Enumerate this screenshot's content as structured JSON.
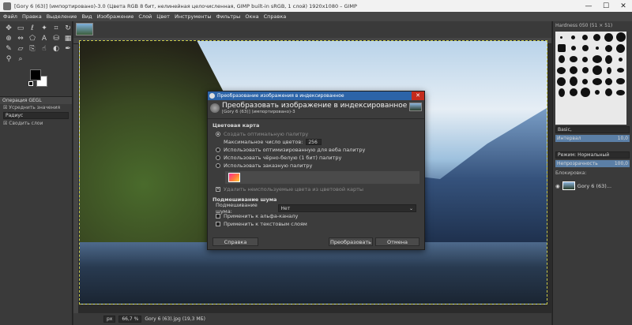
{
  "window": {
    "title": "[Gory 6 (63)] (импортировано)-3.0 (Цвета RGB 8 бит, нелинейная целочисленная, GIMP built-in sRGB, 1 слой) 1920x1080 – GIMP",
    "controls": [
      "—",
      "☐",
      "✕"
    ]
  },
  "menu": [
    "Файл",
    "Правка",
    "Выделение",
    "Вид",
    "Изображение",
    "Слой",
    "Цвет",
    "Инструменты",
    "Фильтры",
    "Окна",
    "Справка"
  ],
  "left_dock": {
    "tab_label": "Операция GEGL",
    "gegl_option": "Усреднить значения",
    "gegl_field": "Радиус",
    "gegl_merge": "Сводить слои"
  },
  "statusbar": {
    "unit": "px",
    "zoom": "66,7 %",
    "info": "Gory 6 (63).jpg (19,3 МБ)"
  },
  "right_dock": {
    "brush_name": "Hardness 050 (51 × 51)",
    "brush_tag": "Basic,",
    "spacing_label": "Интервал",
    "spacing_value": "10,0",
    "mode_label": "Режим: Нормальный",
    "opacity_label": "Непрозрачность",
    "opacity_value": "100,0",
    "lock_label": "Блокировка:",
    "layer_name": "Gory 6 (63)..."
  },
  "dialog": {
    "titlebar": "Преобразование изображения в индексированное",
    "heading": "Преобразовать изображение в индексированное",
    "subheading": "[Gory 6 (63)] (импортировано)-3",
    "section_colormap": "Цветовая карта",
    "opt_optimal": "Создать оптимальную палитру",
    "max_colors_label": "Максимальное число цветов:",
    "max_colors_value": "256",
    "opt_web": "Использовать оптимизированную для веба палитру",
    "opt_bw": "Использовать чёрно-белую (1 бит) палитру",
    "opt_custom": "Использовать заказную палитру",
    "remove_unused": "Удалить неиспользуемые цвета из цветовой карты",
    "section_dither": "Подмешивание шума",
    "dither_label": "Подмешивание шума:",
    "dither_value": "Нет",
    "dither_alpha": "Применить к альфа-каналу",
    "dither_text": "Применить к текстовым слоям",
    "btn_help": "Справка",
    "btn_convert": "Преобразовать",
    "btn_cancel": "Отмена"
  }
}
